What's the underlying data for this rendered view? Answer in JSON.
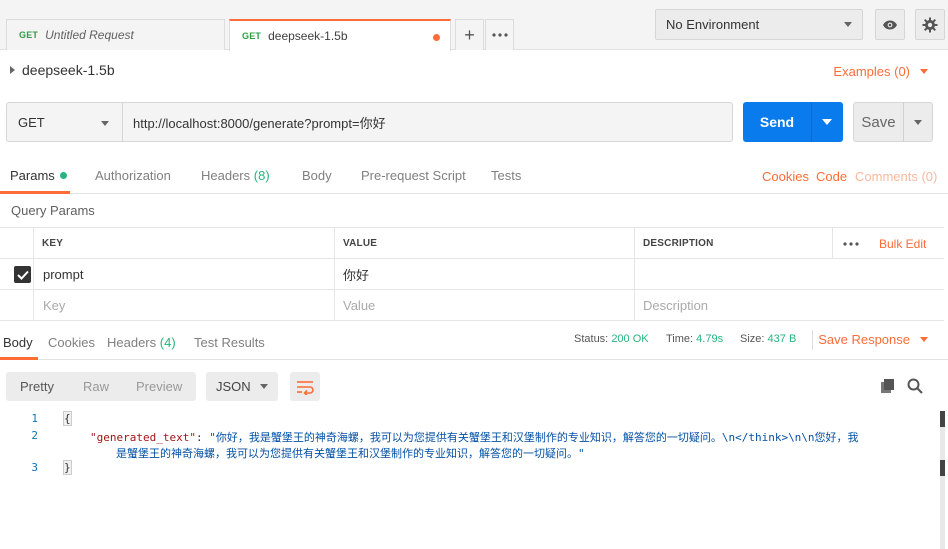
{
  "tabs": [
    {
      "method": "GET",
      "name": "Untitled Request",
      "active": false
    },
    {
      "method": "GET",
      "name": "deepseek-1.5b",
      "active": true,
      "unsaved": true
    }
  ],
  "tab_actions": {
    "add_icon": "plus-icon",
    "more_icon": "more-dots-icon"
  },
  "environment": {
    "selected": "No Environment",
    "eye_icon": "eye-icon",
    "settings_icon": "gear-icon"
  },
  "request": {
    "title": "deepseek-1.5b",
    "examples_label": "Examples (0)",
    "method": "GET",
    "url": "http://localhost:8000/generate?prompt=你好",
    "send_label": "Send",
    "save_label": "Save"
  },
  "request_tabs": {
    "params": "Params",
    "authorization": "Authorization",
    "headers": "Headers",
    "headers_count": "(8)",
    "body": "Body",
    "pre_request": "Pre-request Script",
    "tests": "Tests",
    "cookies": "Cookies",
    "code": "Code",
    "comments": "Comments (0)"
  },
  "query_params": {
    "label": "Query Params",
    "headers": {
      "key": "KEY",
      "value": "VALUE",
      "description": "DESCRIPTION",
      "bulk_edit": "Bulk Edit"
    },
    "rows": [
      {
        "checked": true,
        "key": "prompt",
        "value": "你好",
        "description": ""
      }
    ],
    "placeholders": {
      "key": "Key",
      "value": "Value",
      "description": "Description"
    }
  },
  "response_tabs": {
    "body": "Body",
    "cookies": "Cookies",
    "headers": "Headers",
    "headers_count": "(4)",
    "test_results": "Test Results"
  },
  "response_status": {
    "status_label": "Status:",
    "status_value": "200 OK",
    "time_label": "Time:",
    "time_value": "4.79s",
    "size_label": "Size:",
    "size_value": "437 B",
    "save_response": "Save Response"
  },
  "format_bar": {
    "pretty": "Pretty",
    "raw": "Raw",
    "preview": "Preview",
    "language": "JSON",
    "wrap_icon": "wrap-lines-icon",
    "copy_icon": "copy-icon",
    "search_icon": "search-icon"
  },
  "response_body": {
    "line_numbers": [
      "1",
      "2",
      "3"
    ],
    "open_brace": "{",
    "key": "\"generated_text\"",
    "colon": ": ",
    "value_line1": "\"你好，我是蟹堡王的神奇海螺，我可以为您提供有关蟹堡王和汉堡制作的专业知识，解答您的一切疑问。\\n</think>\\n\\n您好，我",
    "value_line2": "是蟹堡王的神奇海螺，我可以为您提供有关蟹堡王和汉堡制作的专业知识，解答您的一切疑问。\"",
    "close_brace": "}"
  }
}
